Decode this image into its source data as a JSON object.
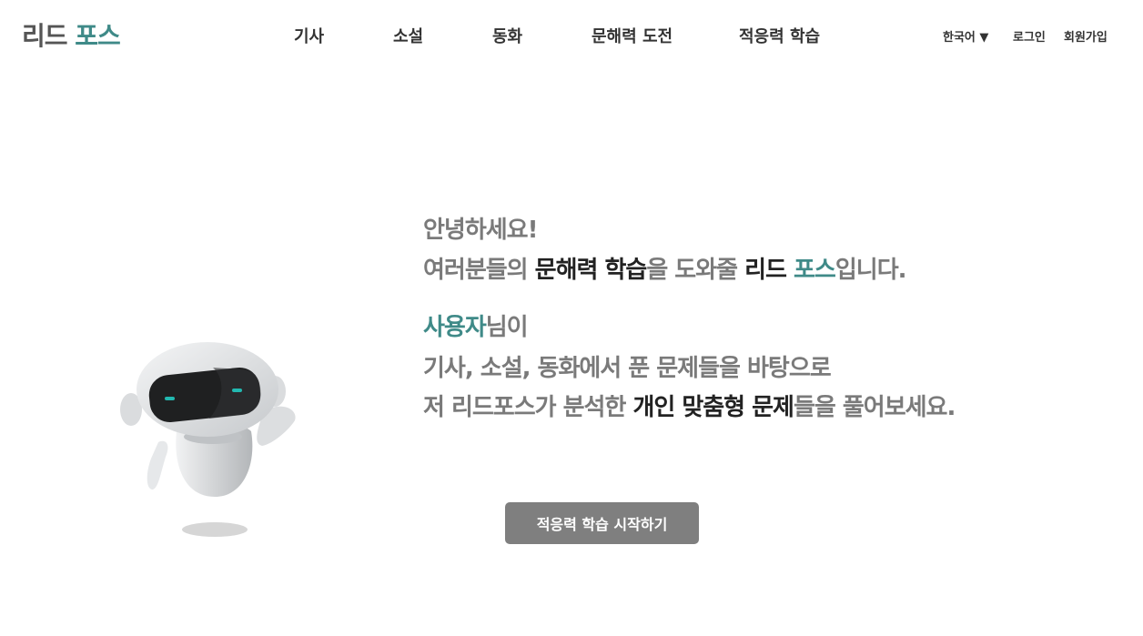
{
  "logo": {
    "part1": "리드",
    "part2": "포스"
  },
  "nav": {
    "items": [
      "기사",
      "소설",
      "동화",
      "문해력 도전",
      "적응력 학습"
    ]
  },
  "header": {
    "language": "한국어 ▼",
    "login": "로그인",
    "signup": "회원가입"
  },
  "hero": {
    "line1": "안녕하세요!",
    "line2a": "여러분들의 ",
    "line2b": "문해력 학습",
    "line2c": "을 도와줄 ",
    "line2d": "리드 ",
    "line2e": "포스",
    "line2f": "입니다.",
    "line3a": "사용자",
    "line3b": "님이",
    "line4": "기사, 소설, 동화에서 푼 문제들을 바탕으로",
    "line5a": "저 리드포스가 분석한 ",
    "line5b": "개인 맞춤형 문제",
    "line5c": "들을 풀어보세요."
  },
  "cta": {
    "label": "적응력 학습 시작하기"
  },
  "colors": {
    "accent": "#3f8a88",
    "button": "#7f7f7f",
    "text_muted": "#7a7a7a",
    "text_dark": "#222222"
  },
  "icons": {
    "mascot": "robot-mascot"
  }
}
